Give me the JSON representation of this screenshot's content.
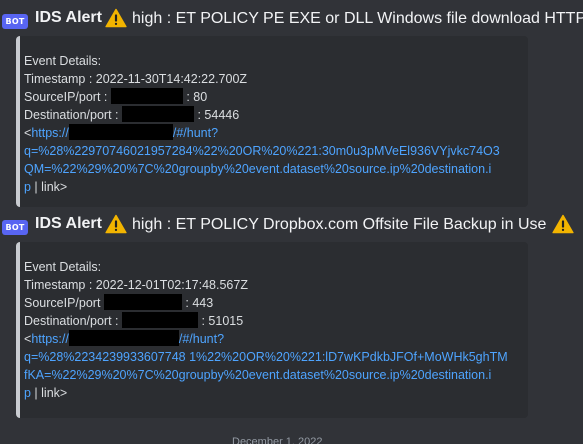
{
  "messages": [
    {
      "badge": "BOT",
      "author": "IDS Alert",
      "title": "high : ET POLICY PE EXE or DLL Windows file download HTTP",
      "embed": {
        "heading": "Event Details:",
        "timestamp": "Timestamp : 2022-11-30T14:42:22.700Z",
        "source_label": "SourceIP/port :",
        "source_port": ": 80",
        "destination_label": "Destination/port :",
        "destination_port": ": 54446",
        "link_prefix": "<",
        "url_start": "https://",
        "url_hunt": "/#/hunt?",
        "url_line2": "q=%28%22970746021957284%22%20OR%20%221:30m0u3pMVeEl936VYjvkc74O3",
        "url_line3": "QM=%22%29%20%7C%20groupby%20event.dataset%20source.ip%20destination.i",
        "url_line4": "p",
        "link_suffix": " | link>"
      }
    },
    {
      "badge": "BOT",
      "author": "IDS Alert",
      "title": "high : ET POLICY Dropbox.com Offsite File Backup in Use",
      "embed": {
        "heading": "Event Details:",
        "timestamp": "Timestamp : 2022-12-01T02:17:48.567Z",
        "source_label": "SourceIP/port",
        "source_port": ": 443",
        "destination_label": "Destination/port :",
        "destination_port": ": 51015",
        "link_prefix": "<",
        "url_start": "https://",
        "url_hunt": "/#/hunt?",
        "url_line2": "q=%28%2234239933607748 1%22%20OR%20%221:lD7wKPdkbJFOf+MoWHk5ghTM",
        "url_line3": "fKA=%22%29%20%7C%20groupby%20event.dataset%20source.ip%20destination.i",
        "url_line4": "p",
        "link_suffix": " | link>"
      }
    }
  ],
  "footer": {
    "date_divider": "December 1, 2022"
  },
  "colors": {
    "background": "#313338",
    "embed_background": "#2b2d31",
    "embed_bar": "#c9ccd1",
    "bot_badge": "#5865f2",
    "link": "#4ea4ff",
    "warning": "#f2b400",
    "redaction": "#000000"
  },
  "icons": {
    "warning": "warning-triangle-icon"
  }
}
